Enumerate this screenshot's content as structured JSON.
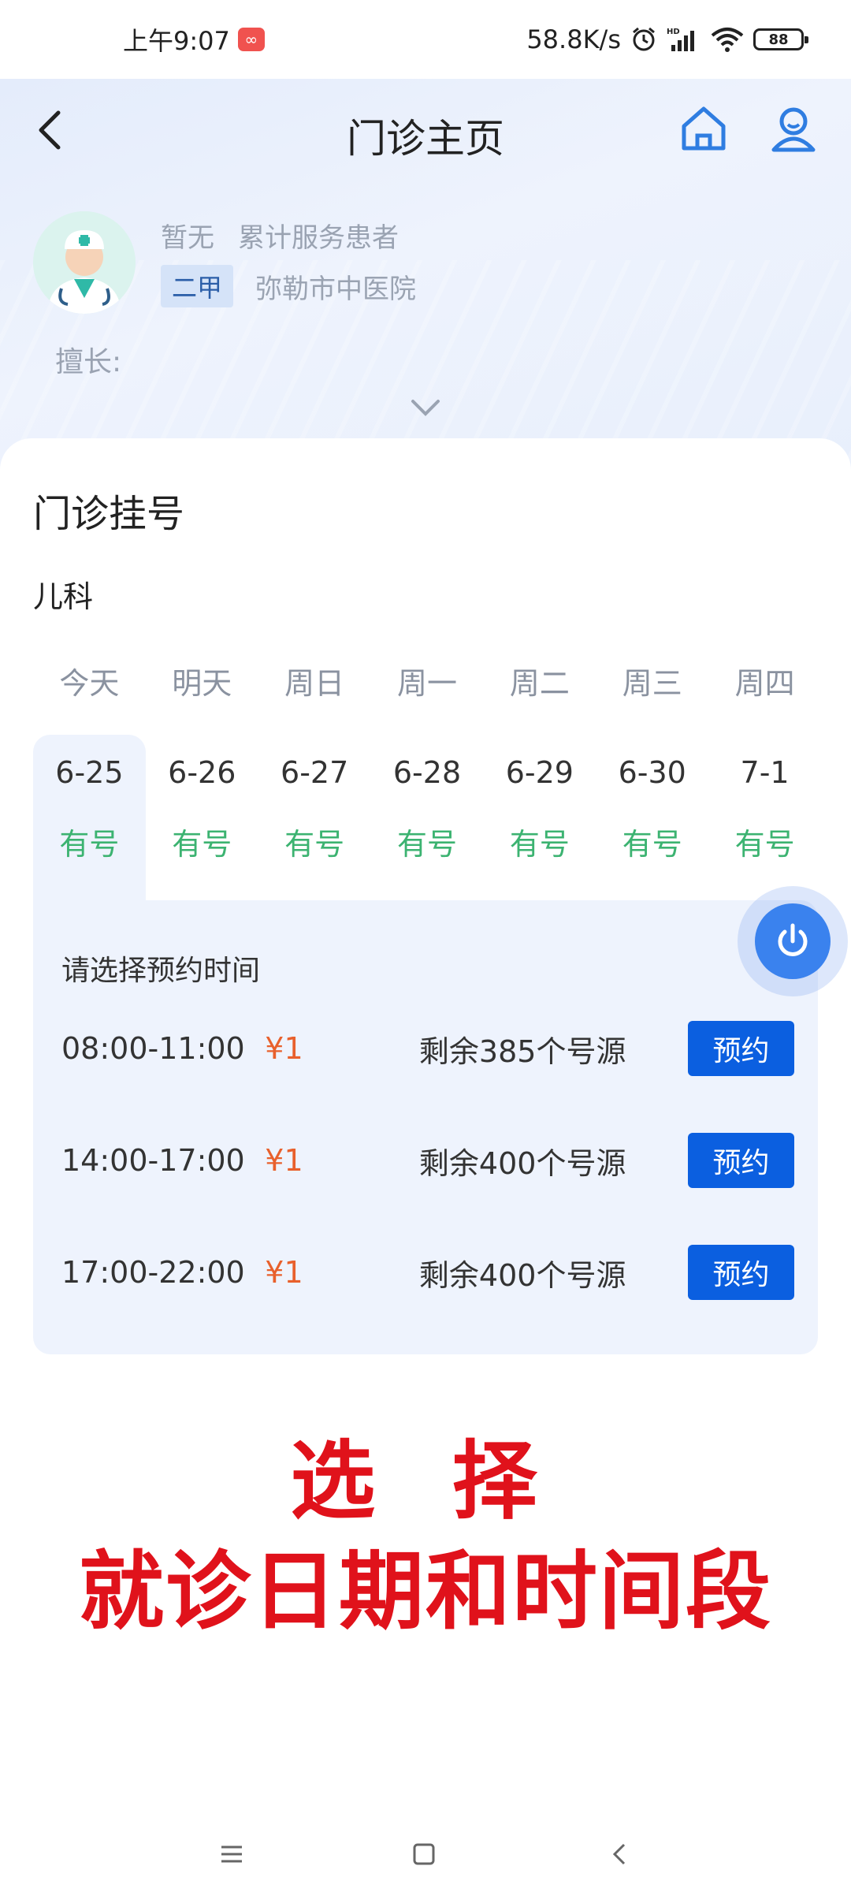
{
  "status_bar": {
    "time": "上午9:07",
    "network_speed": "58.8K/s",
    "battery": "88",
    "icons": [
      "app-notification-icon",
      "alarm-icon",
      "hd-signal-icon",
      "wifi-icon",
      "battery-icon"
    ]
  },
  "nav": {
    "title": "门诊主页",
    "back_icon": "back-icon",
    "home_icon": "home-icon",
    "user_icon": "user-icon",
    "accent": "#2f7de1"
  },
  "doctor": {
    "name_placeholder": "暂无",
    "served_label": "累计服务患者",
    "level": "二甲",
    "hospital": "弥勒市中医院",
    "specialty_label": "擅长:"
  },
  "registration": {
    "title": "门诊挂号",
    "department": "儿科",
    "days": [
      {
        "weekday": "今天",
        "date": "6-25",
        "availability": "有号",
        "selected": true
      },
      {
        "weekday": "明天",
        "date": "6-26",
        "availability": "有号"
      },
      {
        "weekday": "周日",
        "date": "6-27",
        "availability": "有号"
      },
      {
        "weekday": "周一",
        "date": "6-28",
        "availability": "有号"
      },
      {
        "weekday": "周二",
        "date": "6-29",
        "availability": "有号"
      },
      {
        "weekday": "周三",
        "date": "6-30",
        "availability": "有号"
      },
      {
        "weekday": "周四",
        "date": "7-1",
        "availability": "有号"
      }
    ],
    "slots_title": "请选择预约时间",
    "slots": [
      {
        "time": "08:00-11:00",
        "price": "¥1",
        "remaining": "剩余385个号源",
        "button": "预约"
      },
      {
        "time": "14:00-17:00",
        "price": "¥1",
        "remaining": "剩余400个号源",
        "button": "预约"
      },
      {
        "time": "17:00-22:00",
        "price": "¥1",
        "remaining": "剩余400个号源",
        "button": "预约"
      }
    ],
    "colors": {
      "available": "#3cb371",
      "price": "#e8602c",
      "button": "#0b5fe0"
    }
  },
  "caption": {
    "line1": "选 择",
    "line2": "就诊日期和时间段",
    "color": "#e0121b"
  },
  "bottom_nav": [
    "menu-icon",
    "home-square-icon",
    "back-triangle-icon"
  ]
}
